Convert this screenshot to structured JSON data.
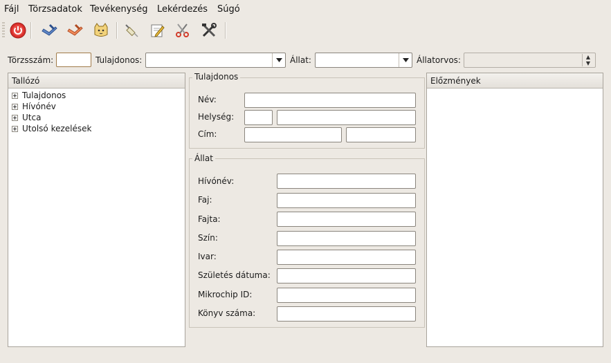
{
  "menubar": {
    "items": [
      "Fájl",
      "Törzsadatok",
      "Tevékenység",
      "Lekérdezés",
      "Súgó"
    ]
  },
  "toolbar": {
    "buttons": [
      "power-icon",
      "blue-check-icon",
      "orange-check-icon",
      "cat-icon",
      "syringe-icon",
      "edit-document-icon",
      "scissors-icon",
      "tools-icon"
    ]
  },
  "filter": {
    "torzsszam_label": "Törzsszám:",
    "torzsszam_value": "",
    "tulajdonos_label": "Tulajdonos:",
    "tulajdonos_value": "",
    "allat_label": "Állat:",
    "allat_value": "",
    "allatorvos_label": "Állatorvos:",
    "allatorvos_value": ""
  },
  "browser": {
    "title": "Tallózó",
    "items": [
      "Tulajdonos",
      "Hívónév",
      "Utca",
      "Utolsó kezelések"
    ]
  },
  "owner": {
    "title": "Tulajdonos",
    "nev_label": "Név:",
    "nev_value": "",
    "helyseg_label": "Helység:",
    "zip_value": "",
    "city_value": "",
    "cim_label": "Cím:",
    "street_value": "",
    "house_value": ""
  },
  "animal": {
    "title": "Állat",
    "fields": [
      {
        "label": "Hívónév:",
        "value": ""
      },
      {
        "label": "Faj:",
        "value": ""
      },
      {
        "label": "Fajta:",
        "value": ""
      },
      {
        "label": "Szín:",
        "value": ""
      },
      {
        "label": "Ivar:",
        "value": ""
      },
      {
        "label": "Születés dátuma:",
        "value": ""
      },
      {
        "label": "Mikrochip ID:",
        "value": ""
      },
      {
        "label": "Könyv száma:",
        "value": ""
      }
    ]
  },
  "history": {
    "title": "Előzmények"
  },
  "colors": {
    "window_bg": "#ede9e3",
    "focus_border": "#a07a48",
    "power_red": "#d9302c"
  }
}
